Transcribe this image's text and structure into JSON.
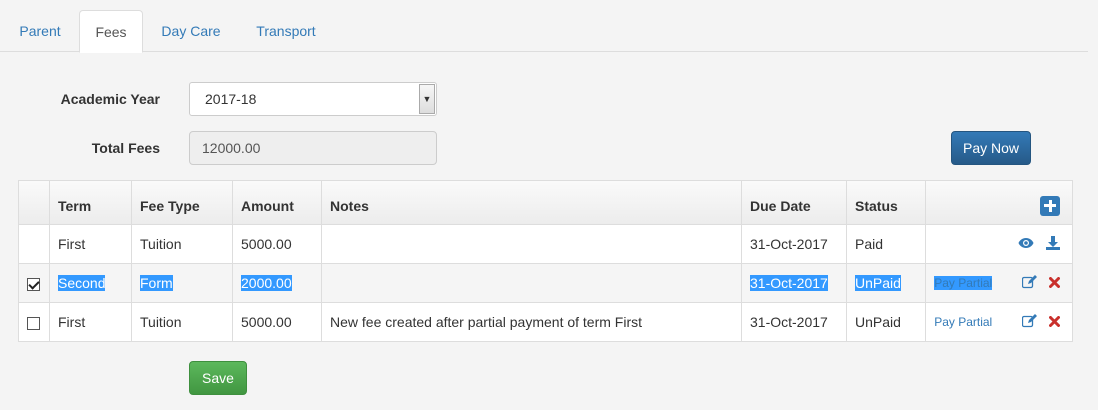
{
  "tabs": [
    {
      "label": "Parent"
    },
    {
      "label": "Fees"
    },
    {
      "label": "Day Care"
    },
    {
      "label": "Transport"
    }
  ],
  "form": {
    "academic_year_label": "Academic Year",
    "academic_year_value": "2017-18",
    "total_fees_label": "Total Fees",
    "total_fees_value": "12000.00",
    "pay_now_label": "Pay Now",
    "save_label": "Save"
  },
  "table": {
    "headers": [
      "Term",
      "Fee Type",
      "Amount",
      "Notes",
      "Due Date",
      "Status"
    ],
    "rows": [
      {
        "term": "First",
        "fee_type": "Tuition",
        "amount": "5000.00",
        "notes": "",
        "due_date": "31-Oct-2017",
        "status": "Paid",
        "pay_partial": ""
      },
      {
        "term": "Second",
        "fee_type": "Form",
        "amount": "2000.00",
        "notes": "",
        "due_date": "31-Oct-2017",
        "status": "UnPaid",
        "pay_partial": "Pay Partial"
      },
      {
        "term": "First",
        "fee_type": "Tuition",
        "amount": "5000.00",
        "notes": "New fee created after partial payment of term First",
        "due_date": "31-Oct-2017",
        "status": "UnPaid",
        "pay_partial": "Pay Partial"
      }
    ]
  },
  "colors": {
    "link": "#337ab7",
    "primary": "#286090",
    "success": "#449d44",
    "danger": "#c9302c",
    "selection": "#3399ff"
  },
  "icons": {
    "add": "plus-square-icon",
    "view": "eye-icon",
    "download": "download-icon",
    "edit": "edit-icon",
    "delete": "remove-icon"
  }
}
